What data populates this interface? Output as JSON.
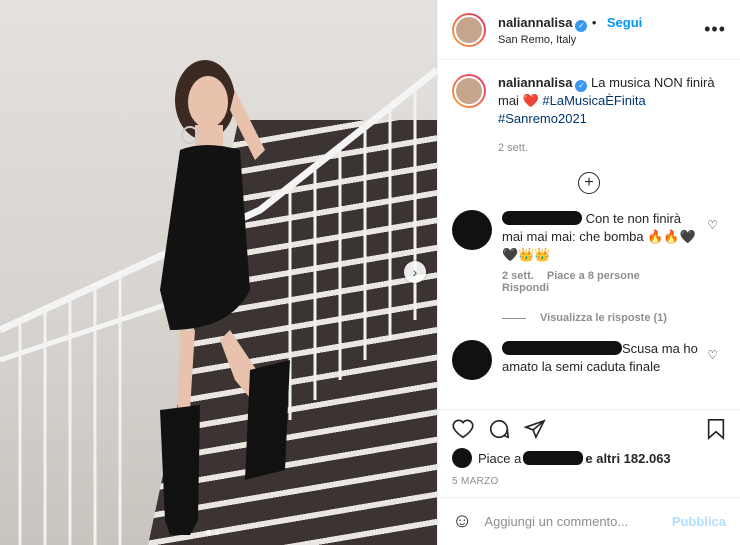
{
  "post": {
    "username": "naliannalisa",
    "follow_label": "Segui",
    "location": "San Remo, Italy",
    "more_label": "•••"
  },
  "caption": {
    "username": "naliannalisa",
    "text": "La musica NON finirà mai",
    "heart": "❤️",
    "tag1": "#LaMusicaÈFinita",
    "tag2": "#Sanremo2021",
    "time": "2 sett."
  },
  "comments": [
    {
      "text_before": "Con te non finirà mai mai mai: che bomba 🔥🔥🖤🖤👑👑",
      "time": "2 sett.",
      "likes": "Piace a 8 persone",
      "reply": "Rispondi",
      "view_replies": "Visualizza le risposte (1)"
    },
    {
      "text_before": "Scusa ma ho amato la semi caduta finale"
    }
  ],
  "likes": {
    "prefix": "Piace a",
    "suffix": "e altri 182.063"
  },
  "date": "5 MARZO",
  "add_comment": {
    "placeholder": "Aggiungi un commento...",
    "publish": "Pubblica"
  },
  "colors": {
    "accent": "#0095f6",
    "publish_disabled": "#b2dffc"
  }
}
